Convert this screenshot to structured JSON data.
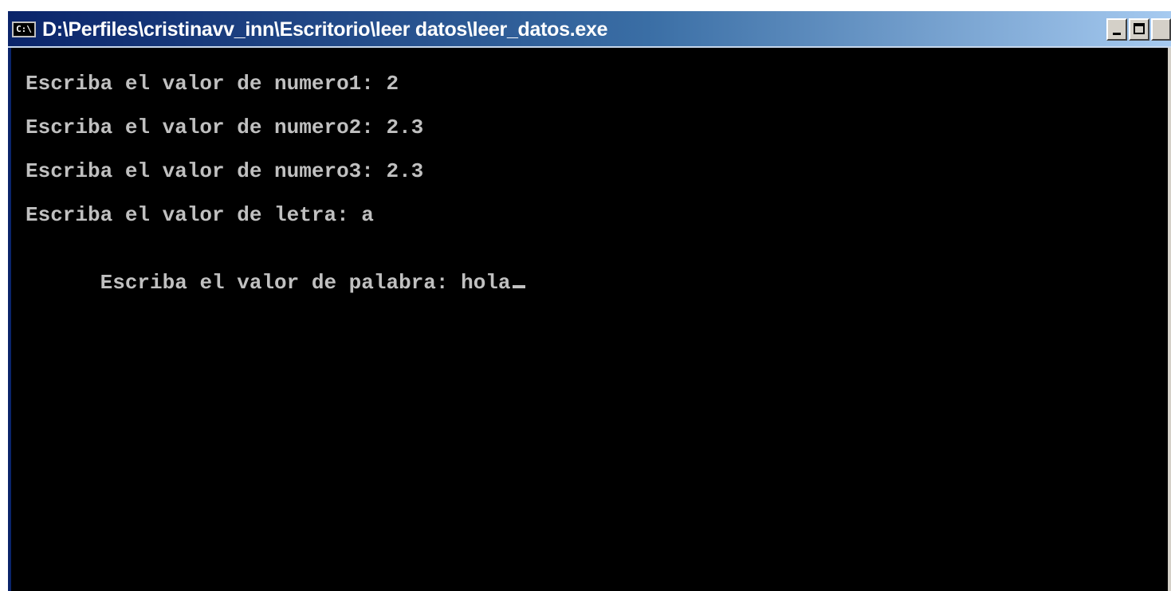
{
  "window": {
    "title": "D:\\Perfiles\\cristinavv_inn\\Escritorio\\leer datos\\leer_datos.exe",
    "icon": "console-app-icon",
    "icon_glyph": "C:\\",
    "controls": {
      "minimize": "minimize-icon",
      "maximize": "maximize-icon",
      "close": "close-icon"
    }
  },
  "console": {
    "lines": [
      "Escriba el valor de numero1: 2",
      "Escriba el valor de numero2: 2.3",
      "Escriba el valor de numero3: 2.3",
      "Escriba el valor de letra: a",
      "Escriba el valor de palabra: hola"
    ],
    "cursor_visible": true,
    "colors": {
      "background": "#000000",
      "text": "#c0c0c0"
    }
  }
}
